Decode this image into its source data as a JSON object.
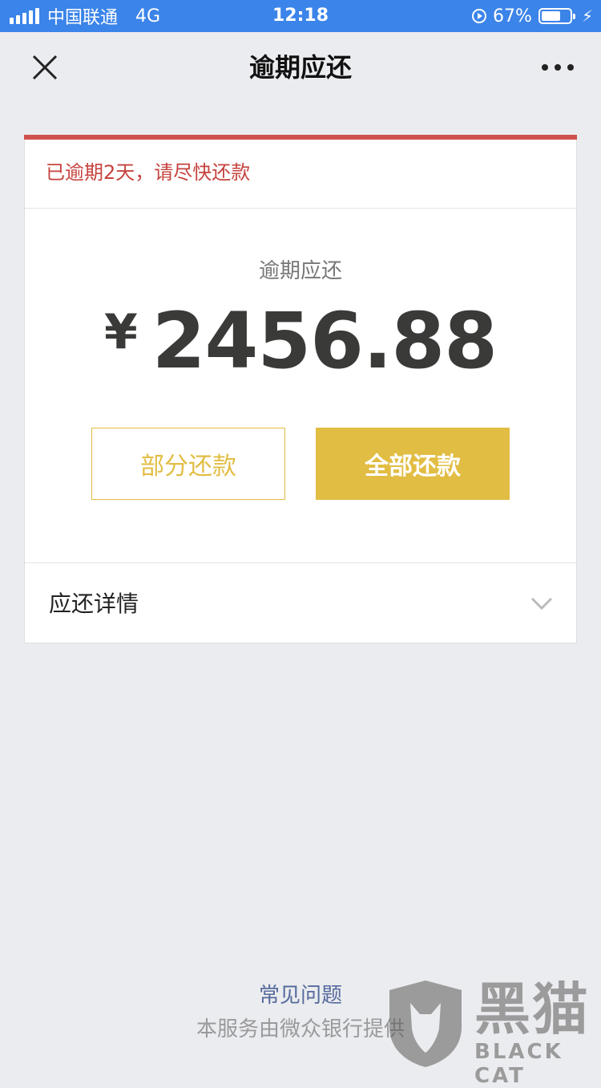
{
  "status_bar": {
    "carrier": "中国联通",
    "network": "4G",
    "time": "12:18",
    "battery": "67%",
    "battery_level": 0.67
  },
  "nav": {
    "title": "逾期应还",
    "close_icon": "close-icon",
    "more_icon": "more-dots-icon"
  },
  "card": {
    "alert": "已逾期2天，请尽快还款",
    "amount_label": "逾期应还",
    "currency": "¥",
    "amount": "2456.88",
    "partial_button": "部分还款",
    "full_button": "全部还款",
    "detail_label": "应还详情"
  },
  "footer": {
    "faq": "常见问题",
    "provider": "本服务由微众银行提供"
  },
  "watermark": {
    "cn": "黑猫",
    "en": "BLACK CAT"
  },
  "colors": {
    "status_bar": "#3b84e9",
    "alert": "#c6433e",
    "accent_gold": "#e2bd44",
    "link": "#566b9d",
    "background": "#ebecef"
  }
}
